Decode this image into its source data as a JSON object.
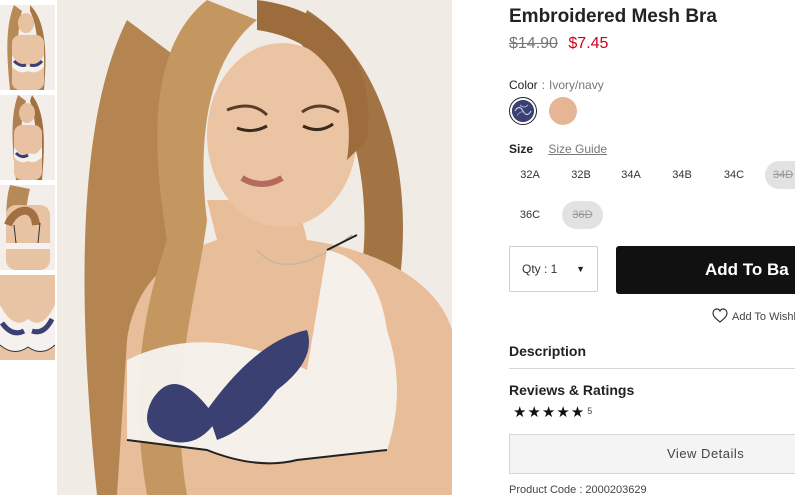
{
  "product": {
    "title": "Embroidered Mesh Bra",
    "old_price": "$14.90",
    "new_price": "$7.45",
    "product_code": "Product Code : 2000203629"
  },
  "color": {
    "label": "Color",
    "separator": ":",
    "selected": "Ivory/navy",
    "swatches": [
      {
        "name": "Ivory/navy",
        "hex": "#3a4072",
        "selected": true
      },
      {
        "name": "Nude",
        "hex": "#e5b595",
        "selected": false
      }
    ]
  },
  "size": {
    "label": "Size",
    "guide": "Size Guide",
    "options": [
      {
        "label": "32A",
        "available": true
      },
      {
        "label": "32B",
        "available": true
      },
      {
        "label": "34A",
        "available": true
      },
      {
        "label": "34B",
        "available": true
      },
      {
        "label": "34C",
        "available": true
      },
      {
        "label": "34D",
        "available": false
      },
      {
        "label": "36C",
        "available": true
      },
      {
        "label": "36D",
        "available": false
      }
    ]
  },
  "quantity": {
    "label": "Qty : 1"
  },
  "actions": {
    "add_to_bag": "Add To Ba",
    "wishlist": "Add To Wishl",
    "view_details": "View Details"
  },
  "sections": {
    "description": "Description",
    "reviews": "Reviews & Ratings",
    "stars": "★★★★★",
    "rating_count": "5"
  },
  "colors": {
    "sale_red": "#d0021b",
    "button_black": "#111111",
    "unavailable_gray": "#e2e2e2"
  }
}
